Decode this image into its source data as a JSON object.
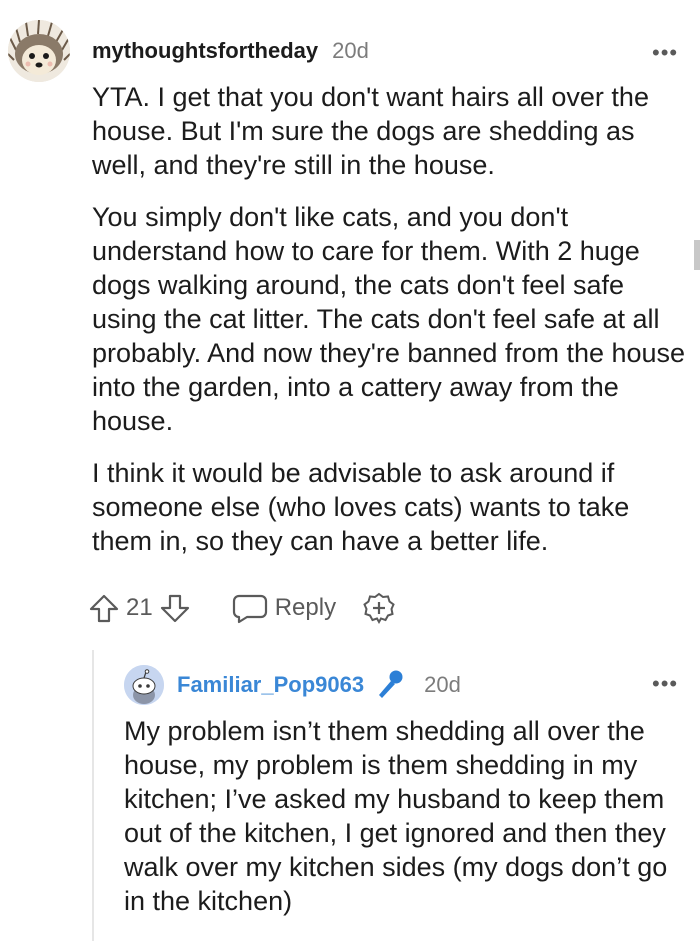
{
  "comment": {
    "author": "mythoughtsfortheday",
    "age": "20d",
    "paragraphs": [
      "YTA. I get that you don't want hairs all over the house. But I'm sure the dogs are shedding as well, and they're still in the house.",
      "You simply don't like cats, and you don't understand how to care for them. With 2 huge dogs walking around, the cats don't feel safe using the cat litter. The cats don't feel safe at all probably. And now they're banned from the house into the garden, into a cattery away from the house.",
      "I think it would be advisable to ask around if someone else (who loves cats) wants to take them in, so they can have a better life."
    ],
    "score": "21",
    "reply_label": "Reply",
    "more_label": "•••"
  },
  "reply": {
    "author": "Familiar_Pop9063",
    "age": "20d",
    "more_label": "•••",
    "text": "My problem isn’t them shedding all over the house, my problem is them shedding in my kitchen; I’ve asked my husband to keep them out of the kitchen, I get ignored and then they walk over my kitchen sides (my dogs don’t go in the kitchen)"
  },
  "colors": {
    "text": "#1c1c1c",
    "meta": "#7c7c7c",
    "reply_author": "#3a87d6",
    "op_badge": "#2c7fd6"
  },
  "icons": [
    "hedgehog-avatar",
    "more-icon",
    "upvote-icon",
    "downvote-icon",
    "reply-icon",
    "award-icon",
    "snoo-avatar",
    "microphone-icon"
  ]
}
